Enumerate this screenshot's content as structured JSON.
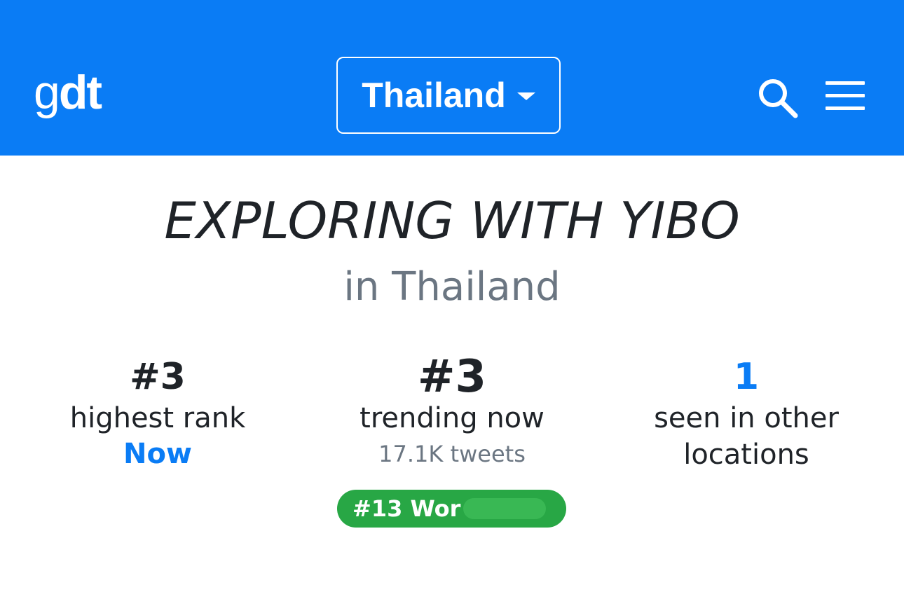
{
  "header": {
    "logo_part1": "g",
    "logo_part2": "dt",
    "country_selected": "Thailand",
    "search_icon": "search-icon",
    "menu_icon": "hamburger-menu-icon",
    "bg_color": "#0a7cf5"
  },
  "trend": {
    "title": "EXPLORING WITH YIBO",
    "location": "in Thailand"
  },
  "stats": {
    "highest_rank": {
      "value": "#3",
      "label": "highest rank",
      "when": "Now"
    },
    "trending_now": {
      "value": "#3",
      "label": "trending now",
      "tweets": "17.1K tweets"
    },
    "other_locations": {
      "value": "1",
      "label_line1": "seen in other",
      "label_line2": "locations"
    }
  },
  "badge": {
    "text": "#13 Wor",
    "color": "#28a745"
  }
}
